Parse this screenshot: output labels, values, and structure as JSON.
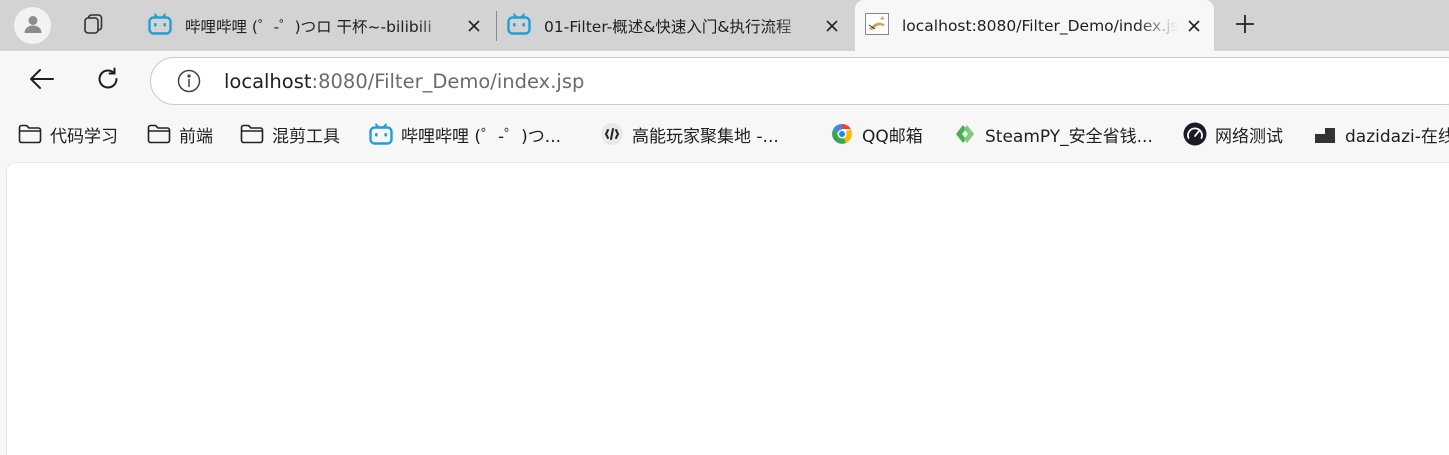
{
  "tabs": [
    {
      "title": "哔哩哔哩 (゜-゜)つロ 干杯~-bilibili",
      "favicon": "bilibili-icon"
    },
    {
      "title": "01-Filter-概述&快速入门&执行流程",
      "favicon": "bilibili-icon"
    },
    {
      "title": "localhost:8080/Filter_Demo/index.jsp",
      "favicon": "tomcat-icon",
      "active": true
    }
  ],
  "address": {
    "host": "localhost",
    "rest": ":8080/Filter_Demo/index.jsp"
  },
  "bookmarks": [
    {
      "label": "代码学习",
      "icon": "folder-icon"
    },
    {
      "label": "前端",
      "icon": "folder-icon"
    },
    {
      "label": "混剪工具",
      "icon": "folder-icon"
    },
    {
      "label": "哔哩哔哩 (゜-゜)つ...",
      "icon": "bilibili-icon"
    },
    {
      "label": "高能玩家聚集地 -...",
      "icon": "gamer-icon"
    },
    {
      "label": "QQ邮箱",
      "icon": "qqmail-icon"
    },
    {
      "label": "SteamPY_安全省钱...",
      "icon": "steampy-icon"
    },
    {
      "label": "网络测试",
      "icon": "speedtest-icon"
    },
    {
      "label": "dazidazi-在线",
      "icon": "dazidazi-icon"
    }
  ],
  "colors": {
    "tabbar": "#d3d3d3",
    "bilibili": "#1ea0d7",
    "content": "#ffffff"
  }
}
